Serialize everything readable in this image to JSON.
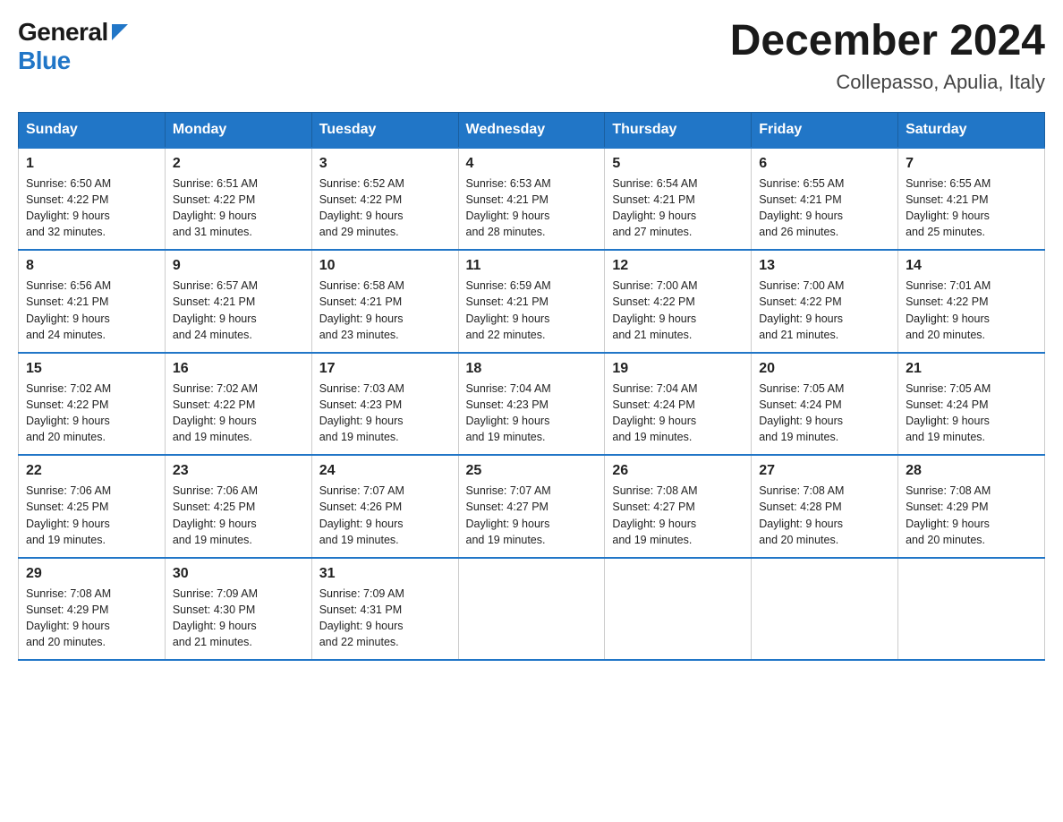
{
  "logo": {
    "general": "General",
    "blue": "Blue",
    "triangle": "▲"
  },
  "title": "December 2024",
  "location": "Collepasso, Apulia, Italy",
  "days_of_week": [
    "Sunday",
    "Monday",
    "Tuesday",
    "Wednesday",
    "Thursday",
    "Friday",
    "Saturday"
  ],
  "weeks": [
    [
      {
        "day": "1",
        "sunrise": "6:50 AM",
        "sunset": "4:22 PM",
        "daylight": "9 hours and 32 minutes."
      },
      {
        "day": "2",
        "sunrise": "6:51 AM",
        "sunset": "4:22 PM",
        "daylight": "9 hours and 31 minutes."
      },
      {
        "day": "3",
        "sunrise": "6:52 AM",
        "sunset": "4:22 PM",
        "daylight": "9 hours and 29 minutes."
      },
      {
        "day": "4",
        "sunrise": "6:53 AM",
        "sunset": "4:21 PM",
        "daylight": "9 hours and 28 minutes."
      },
      {
        "day": "5",
        "sunrise": "6:54 AM",
        "sunset": "4:21 PM",
        "daylight": "9 hours and 27 minutes."
      },
      {
        "day": "6",
        "sunrise": "6:55 AM",
        "sunset": "4:21 PM",
        "daylight": "9 hours and 26 minutes."
      },
      {
        "day": "7",
        "sunrise": "6:55 AM",
        "sunset": "4:21 PM",
        "daylight": "9 hours and 25 minutes."
      }
    ],
    [
      {
        "day": "8",
        "sunrise": "6:56 AM",
        "sunset": "4:21 PM",
        "daylight": "9 hours and 24 minutes."
      },
      {
        "day": "9",
        "sunrise": "6:57 AM",
        "sunset": "4:21 PM",
        "daylight": "9 hours and 24 minutes."
      },
      {
        "day": "10",
        "sunrise": "6:58 AM",
        "sunset": "4:21 PM",
        "daylight": "9 hours and 23 minutes."
      },
      {
        "day": "11",
        "sunrise": "6:59 AM",
        "sunset": "4:21 PM",
        "daylight": "9 hours and 22 minutes."
      },
      {
        "day": "12",
        "sunrise": "7:00 AM",
        "sunset": "4:22 PM",
        "daylight": "9 hours and 21 minutes."
      },
      {
        "day": "13",
        "sunrise": "7:00 AM",
        "sunset": "4:22 PM",
        "daylight": "9 hours and 21 minutes."
      },
      {
        "day": "14",
        "sunrise": "7:01 AM",
        "sunset": "4:22 PM",
        "daylight": "9 hours and 20 minutes."
      }
    ],
    [
      {
        "day": "15",
        "sunrise": "7:02 AM",
        "sunset": "4:22 PM",
        "daylight": "9 hours and 20 minutes."
      },
      {
        "day": "16",
        "sunrise": "7:02 AM",
        "sunset": "4:22 PM",
        "daylight": "9 hours and 19 minutes."
      },
      {
        "day": "17",
        "sunrise": "7:03 AM",
        "sunset": "4:23 PM",
        "daylight": "9 hours and 19 minutes."
      },
      {
        "day": "18",
        "sunrise": "7:04 AM",
        "sunset": "4:23 PM",
        "daylight": "9 hours and 19 minutes."
      },
      {
        "day": "19",
        "sunrise": "7:04 AM",
        "sunset": "4:24 PM",
        "daylight": "9 hours and 19 minutes."
      },
      {
        "day": "20",
        "sunrise": "7:05 AM",
        "sunset": "4:24 PM",
        "daylight": "9 hours and 19 minutes."
      },
      {
        "day": "21",
        "sunrise": "7:05 AM",
        "sunset": "4:24 PM",
        "daylight": "9 hours and 19 minutes."
      }
    ],
    [
      {
        "day": "22",
        "sunrise": "7:06 AM",
        "sunset": "4:25 PM",
        "daylight": "9 hours and 19 minutes."
      },
      {
        "day": "23",
        "sunrise": "7:06 AM",
        "sunset": "4:25 PM",
        "daylight": "9 hours and 19 minutes."
      },
      {
        "day": "24",
        "sunrise": "7:07 AM",
        "sunset": "4:26 PM",
        "daylight": "9 hours and 19 minutes."
      },
      {
        "day": "25",
        "sunrise": "7:07 AM",
        "sunset": "4:27 PM",
        "daylight": "9 hours and 19 minutes."
      },
      {
        "day": "26",
        "sunrise": "7:08 AM",
        "sunset": "4:27 PM",
        "daylight": "9 hours and 19 minutes."
      },
      {
        "day": "27",
        "sunrise": "7:08 AM",
        "sunset": "4:28 PM",
        "daylight": "9 hours and 20 minutes."
      },
      {
        "day": "28",
        "sunrise": "7:08 AM",
        "sunset": "4:29 PM",
        "daylight": "9 hours and 20 minutes."
      }
    ],
    [
      {
        "day": "29",
        "sunrise": "7:08 AM",
        "sunset": "4:29 PM",
        "daylight": "9 hours and 20 minutes."
      },
      {
        "day": "30",
        "sunrise": "7:09 AM",
        "sunset": "4:30 PM",
        "daylight": "9 hours and 21 minutes."
      },
      {
        "day": "31",
        "sunrise": "7:09 AM",
        "sunset": "4:31 PM",
        "daylight": "9 hours and 22 minutes."
      },
      null,
      null,
      null,
      null
    ]
  ],
  "labels": {
    "sunrise": "Sunrise:",
    "sunset": "Sunset:",
    "daylight": "Daylight:"
  }
}
